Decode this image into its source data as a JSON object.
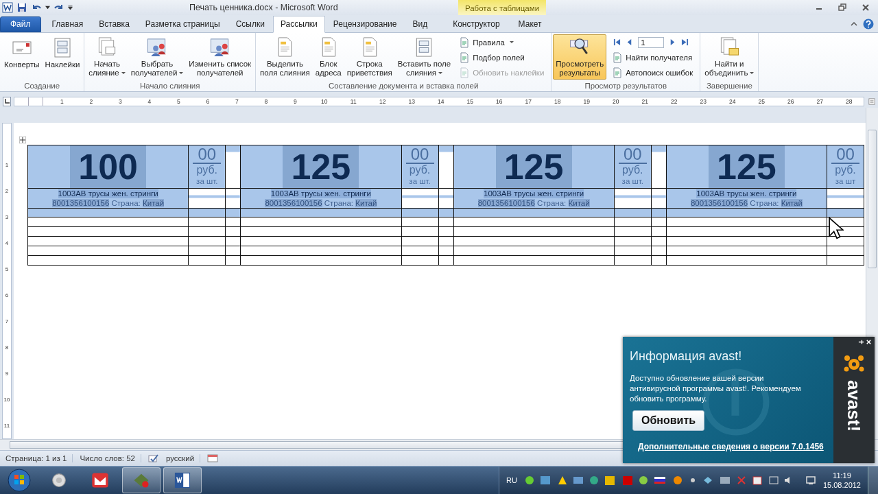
{
  "title_bar": {
    "title": "Печать ценника.docx - Microsoft Word",
    "context_group": "Работа с таблицами"
  },
  "tabs": [
    {
      "label": "Файл",
      "kind": "file",
      "selected": false
    },
    {
      "label": "Главная",
      "kind": "normal",
      "selected": false
    },
    {
      "label": "Вставка",
      "kind": "normal",
      "selected": false
    },
    {
      "label": "Разметка страницы",
      "kind": "normal",
      "selected": false
    },
    {
      "label": "Ссылки",
      "kind": "normal",
      "selected": false
    },
    {
      "label": "Рассылки",
      "kind": "normal",
      "selected": true
    },
    {
      "label": "Рецензирование",
      "kind": "normal",
      "selected": false
    },
    {
      "label": "Вид",
      "kind": "normal",
      "selected": false
    },
    {
      "label": "Конструктор",
      "kind": "contextual",
      "selected": false
    },
    {
      "label": "Макет",
      "kind": "contextual",
      "selected": false
    }
  ],
  "ribbon": {
    "groups": [
      {
        "title": "Создание",
        "items": [
          {
            "kind": "large",
            "label": "Конверты",
            "dropdown": false,
            "pressed": false
          },
          {
            "kind": "large",
            "label": "Наклейки",
            "dropdown": false,
            "pressed": false
          }
        ]
      },
      {
        "title": "Начало слияния",
        "items": [
          {
            "kind": "large",
            "label": "Начать\nслияние",
            "dropdown": true,
            "pressed": false
          },
          {
            "kind": "large",
            "label": "Выбрать\nполучателей",
            "dropdown": true,
            "pressed": false
          },
          {
            "kind": "large",
            "label": "Изменить список\nполучателей",
            "dropdown": false,
            "pressed": false
          }
        ]
      },
      {
        "title": "Составление документа и вставка полей",
        "items": [
          {
            "kind": "large",
            "label": "Выделить\nполя слияния",
            "dropdown": false,
            "pressed": false
          },
          {
            "kind": "large",
            "label": "Блок\nадреса",
            "dropdown": false,
            "pressed": false
          },
          {
            "kind": "large",
            "label": "Строка\nприветствия",
            "dropdown": false,
            "pressed": false
          },
          {
            "kind": "large",
            "label": "Вставить поле\nслияния",
            "dropdown": true,
            "pressed": false
          },
          {
            "kind": "column",
            "items": [
              {
                "kind": "small",
                "label": "Правила",
                "dropdown": true,
                "disabled": false
              },
              {
                "kind": "small",
                "label": "Подбор полей",
                "dropdown": false,
                "disabled": false
              },
              {
                "kind": "small",
                "label": "Обновить наклейки",
                "dropdown": false,
                "disabled": true
              }
            ]
          }
        ]
      },
      {
        "title": "Просмотр результатов",
        "items": [
          {
            "kind": "large",
            "label": "Просмотреть\nрезультаты",
            "dropdown": false,
            "pressed": true
          },
          {
            "kind": "column",
            "items": [
              {
                "kind": "nav",
                "record": "1"
              },
              {
                "kind": "small",
                "label": "Найти получателя",
                "dropdown": false,
                "disabled": false
              },
              {
                "kind": "small",
                "label": "Автопоиск ошибок",
                "dropdown": false,
                "disabled": false
              }
            ]
          }
        ]
      },
      {
        "title": "Завершение",
        "items": [
          {
            "kind": "large",
            "label": "Найти и\nобъединить",
            "dropdown": true,
            "pressed": false
          }
        ]
      }
    ]
  },
  "ruler": {
    "horizontal": [
      "1",
      "2",
      "3",
      "4",
      "5",
      "6",
      "7",
      "8",
      "9",
      "10",
      "11",
      "12",
      "13",
      "14",
      "15",
      "16",
      "17",
      "18",
      "19",
      "20",
      "21",
      "22",
      "23",
      "24",
      "25",
      "26",
      "27",
      "28"
    ],
    "vertical": [
      "1",
      "2",
      "3",
      "4",
      "5",
      "6",
      "7",
      "8",
      "9",
      "10",
      "11"
    ]
  },
  "price_tags": [
    {
      "price": "100",
      "kopecks": "00",
      "currency": "руб.",
      "unit": "за шт.",
      "product": "1003АВ трусы жен. стринги",
      "barcode": "8001356100156",
      "country_label": "Страна:",
      "country": "Китай",
      "selected": true
    },
    {
      "price": "125",
      "kopecks": "00",
      "currency": "руб.",
      "unit": "за шт.",
      "product": "1003АВ трусы жен. стринги",
      "barcode": "8001356100156",
      "country_label": "Страна:",
      "country": "Китай",
      "selected": true
    },
    {
      "price": "125",
      "kopecks": "00",
      "currency": "руб.",
      "unit": "за шт.",
      "product": "1003АВ трусы жен. стринги",
      "barcode": "8001356100156",
      "country_label": "Страна:",
      "country": "Китай",
      "selected": true
    },
    {
      "price": "125",
      "kopecks": "00",
      "currency": "руб.",
      "unit": "за шт",
      "product": "1003АВ трусы жен. стринги",
      "barcode": "8001356100156",
      "country_label": "Страна:",
      "country": "Китай",
      "selected": true
    }
  ],
  "status_bar": {
    "page": "Страница: 1 из 1",
    "words": "Число слов: 52",
    "language": "русский"
  },
  "notification": {
    "title": "Информация avast!",
    "message": "Доступно обновление вашей версии антивирусной программы avast!. Рекомендуем обновить программу.",
    "button": "Обновить",
    "link": "Дополнительные сведения о версии 7.0.1456",
    "logo": "avast!"
  },
  "taskbar": {
    "apps": [
      {
        "running": false
      },
      {
        "running": false
      },
      {
        "running": true
      },
      {
        "running": true
      }
    ],
    "language": "RU",
    "time": "11:19",
    "date": "15.08.2012"
  }
}
